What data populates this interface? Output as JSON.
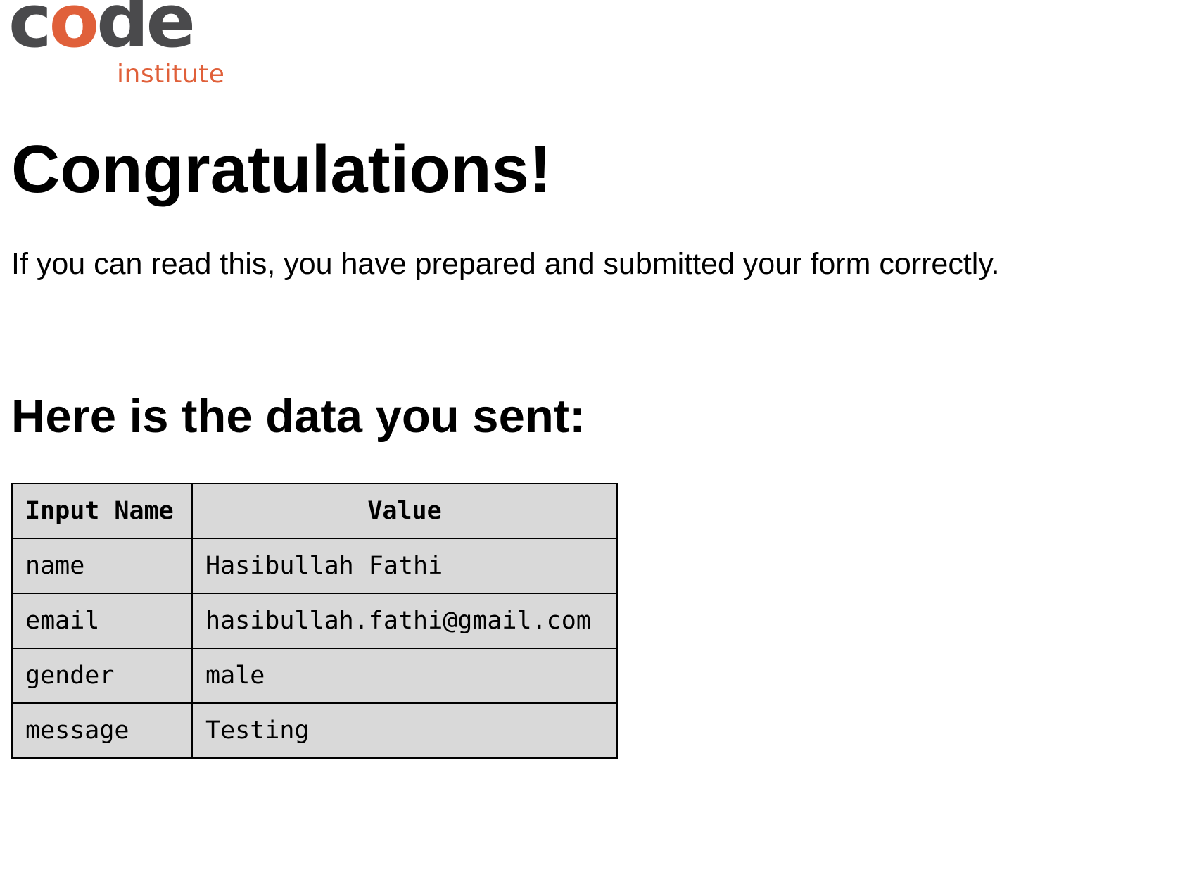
{
  "logo": {
    "word_prefix": "c",
    "word_accent": "o",
    "word_suffix": "de",
    "subtitle": "institute",
    "colors": {
      "dark": "#4a4a4c",
      "accent": "#e0603a"
    }
  },
  "heading": "Congratulations!",
  "intro": "If you can read this, you have prepared and submitted your form correctly.",
  "subheading": "Here is the data you sent:",
  "table": {
    "headers": [
      "Input Name",
      "Value"
    ],
    "rows": [
      [
        "name",
        "Hasibullah Fathi"
      ],
      [
        "email",
        "hasibullah.fathi@gmail.com"
      ],
      [
        "gender",
        "male"
      ],
      [
        "message",
        "Testing"
      ]
    ],
    "background": "#d9d9d9"
  }
}
